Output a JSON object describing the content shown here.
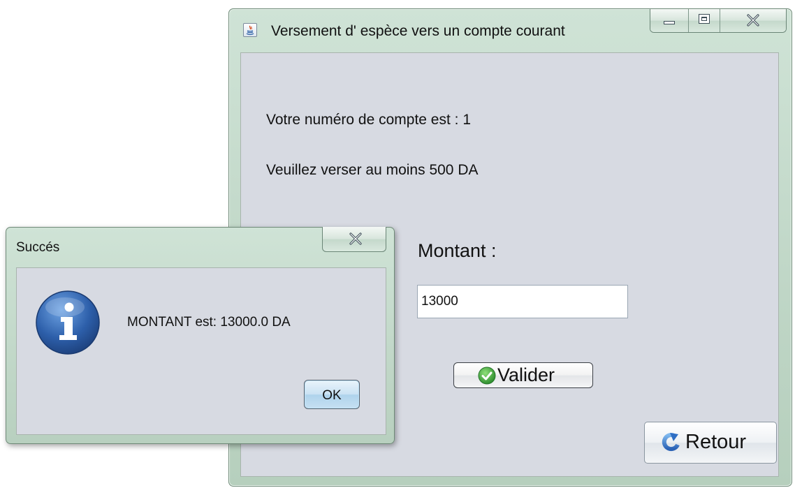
{
  "main_window": {
    "title": "Versement d' espèce vers un compte courant",
    "account_line": "Votre numéro de compte est : 1",
    "min_line": "Veuillez verser au moins 500 DA",
    "amount_label": "Montant :",
    "amount_value": "13000",
    "validate_label": "Valider",
    "back_label": "Retour",
    "icons": [
      "java-app-icon",
      "minimize-icon",
      "maximize-icon",
      "close-icon",
      "checkmark-icon",
      "back-arrow-icon"
    ]
  },
  "dialog": {
    "title": "Succés",
    "message": "MONTANT est: 13000.0 DA",
    "ok_label": "OK",
    "icons": [
      "close-icon",
      "info-icon"
    ]
  },
  "colors": {
    "frame_green": "#c3d9ca",
    "content_gray": "#d7dae2",
    "info_blue": "#2d5faa",
    "check_green": "#3aa23a"
  }
}
